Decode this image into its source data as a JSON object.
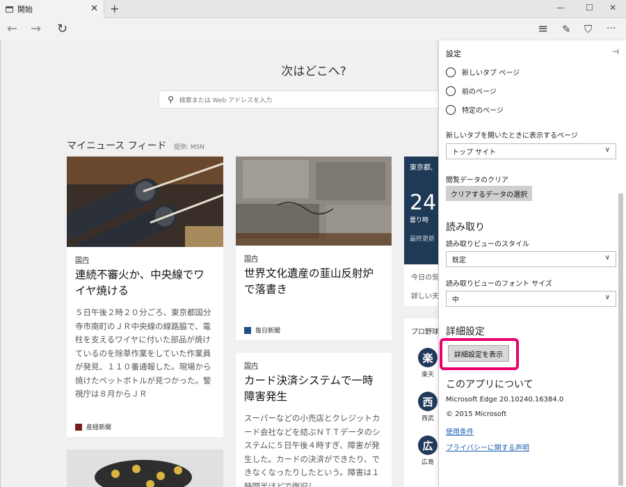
{
  "tab": {
    "title": "開始",
    "close": "✕",
    "new_tab": "+"
  },
  "window": {
    "minimize": "—",
    "maximize": "☐",
    "close": "✕"
  },
  "toolbar": {
    "back": "←",
    "forward": "→",
    "refresh": "↻",
    "hub": "≡",
    "note": "✎",
    "share": "⛉",
    "more": "···"
  },
  "start": {
    "heading": "次はどこへ?",
    "search_placeholder": "検索または Web アドレスを入力",
    "feed_title": "マイニュース フィード",
    "feed_provider": "提供: MSN"
  },
  "cards": [
    {
      "category": "国内",
      "headline": "連続不審火か、中央線でワイヤ焼ける",
      "body": "５日午後２時２０分ごろ、東京都国分寺市南町のＪＲ中央線の線路脇で、電柱を支えるワイヤに付いた部品が焼けているのを除草作業をしていた作業員が発見、１１０番通報した。現場から焼けたペットボトルが見つかった。警視庁は８月からＪＲ",
      "source": "産経新聞"
    },
    {
      "category": "国内",
      "headline": "世界文化遺産の韮山反射炉で落書き",
      "source": "毎日新聞"
    },
    {
      "category": "国内",
      "headline": "カード決済システムで一時障害発生",
      "body": "スーパーなどの小売店とクレジットカード会社などを結ぶＮＴＴデータのシステムに５日午後４時すぎ、障害が発生した。カードの決済ができたり、できなくなったりしたという。障害は１時間半ほどで復旧し"
    }
  ],
  "weather": {
    "city": "東京都, ",
    "temp": "24",
    "condition": "曇り時",
    "updated": "最終更新",
    "link1": "今日の気",
    "link2": "詳しい天"
  },
  "sports": {
    "header": "プロ野球",
    "teams": [
      {
        "badge": "楽",
        "name": "楽天"
      },
      {
        "badge": "西",
        "name": "西武"
      },
      {
        "badge": "広",
        "name": "広島"
      }
    ]
  },
  "settings": {
    "title": "設定",
    "pin": "⊣",
    "radio_new_tab": "新しいタブ ページ",
    "radio_prev_page": "前のページ",
    "radio_specific": "特定のページ",
    "new_tab_label": "新しいタブを開いたときに表示するページ",
    "new_tab_value": "トップ サイト",
    "clear_label": "閲覧データのクリア",
    "clear_button": "クリアするデータの選択",
    "reading_heading": "読み取り",
    "reading_style_label": "読み取りビューのスタイル",
    "reading_style_value": "既定",
    "reading_font_label": "読み取りビューのフォント サイズ",
    "reading_font_value": "中",
    "advanced_heading": "詳細設定",
    "advanced_button": "詳細設定を表示",
    "about_heading": "このアプリについて",
    "version": "Microsoft Edge 20.10240.16384.0",
    "copyright": "© 2015 Microsoft",
    "terms_link": "使用条件",
    "privacy_link": "プライバシーに関する声明",
    "chevron": "∨"
  },
  "colors": {
    "highlight": "#e8006e",
    "link": "#1a5fb4",
    "weather_bg": "#1f3a57"
  }
}
